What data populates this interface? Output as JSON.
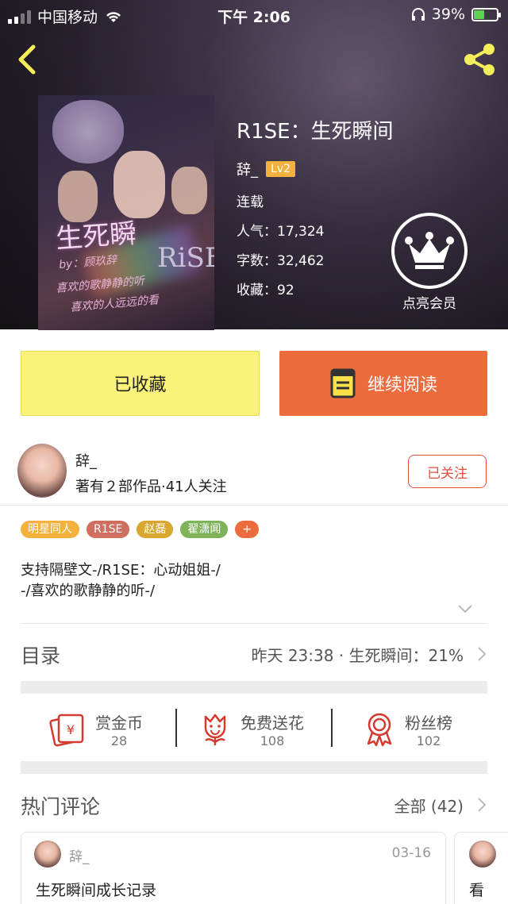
{
  "statusbar": {
    "carrier": "中国移动",
    "time": "下午 2:06",
    "battery": "39%"
  },
  "book": {
    "title": "R1SE：生死瞬间",
    "author": "辞_",
    "level": "Lv2",
    "status": "连载",
    "popularity": "人气：17,324",
    "words": "字数：32,462",
    "favorites": "收藏：92",
    "cover_title": "生死瞬",
    "cover_rise": "RiSE",
    "cover_byline": "by：顾玖辞",
    "cover_line1": "喜欢的歌静静的听",
    "cover_line2": "喜欢的人远远的看"
  },
  "vip": {
    "label": "点亮会员"
  },
  "actions": {
    "favorited": "已收藏",
    "continue_read": "继续阅读"
  },
  "author_card": {
    "name": "辞_",
    "meta": "著有２部作品·41人关注",
    "follow": "已关注"
  },
  "tags": [
    {
      "label": "明星同人",
      "color": "#f3b23e"
    },
    {
      "label": "R1SE",
      "color": "#cf6f5f"
    },
    {
      "label": "赵磊",
      "color": "#d9a72f"
    },
    {
      "label": "翟潇闻",
      "color": "#7fb35a"
    },
    {
      "label": "+",
      "color": "#ed6c3e"
    }
  ],
  "description": {
    "line1": "支持隔壁文-/R1SE：心动姐姐-/",
    "line2": "-/喜欢的歌静静的听-/"
  },
  "toc": {
    "title": "目录",
    "latest": "昨天 23:38 · 生死瞬间：21%"
  },
  "stats": [
    {
      "label": "赏金币",
      "value": "28",
      "icon": "red-envelope-icon"
    },
    {
      "label": "免费送花",
      "value": "108",
      "icon": "flower-icon"
    },
    {
      "label": "粉丝榜",
      "value": "102",
      "icon": "medal-icon"
    }
  ],
  "hot_comments": {
    "title": "热门评论",
    "all": "全部 (42)"
  },
  "comments": [
    {
      "name": "辞_",
      "date": "03-16",
      "text": "生死瞬间成长记录"
    },
    {
      "text": "看"
    }
  ]
}
